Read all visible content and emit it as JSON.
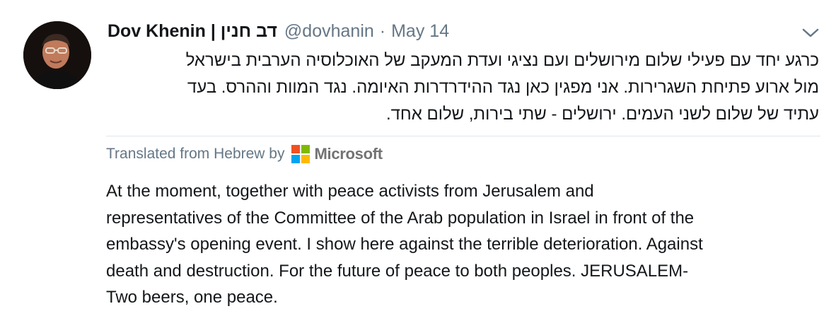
{
  "tweet": {
    "author_name": "Dov Khenin | דב חנין",
    "handle": "@dovhanin",
    "separator": "·",
    "date": "May 14",
    "hebrew_lines": [
      "כרגע יחד עם פעילי שלום מירושלים ועם נציגי ועדת המעקב של האוכלוסיה הערבית בישראל",
      "מול ארוע פתיחת השגרירות. אני מפגין כאן נגד ההידרדרות האיומה. נגד המוות וההרס. בעד",
      "עתיד של שלום לשני העמים. ירושלים - שתי בירות, שלום אחד."
    ],
    "translated_label": "Translated from Hebrew by",
    "translator_name": "Microsoft",
    "english_lines": [
      "At the moment, together with peace activists from Jerusalem and",
      "representatives of the Committee of the Arab population in Israel in front of the",
      "embassy's opening event. I show here against the terrible deterioration. Against",
      "death and destruction. For the future of peace to both peoples. JERUSALEM-",
      "Two beers, one peace."
    ]
  },
  "icons": {
    "avatar": "profile-photo",
    "menu": "chevron-down-icon",
    "translator_logo": "microsoft-logo-icon"
  },
  "colors": {
    "text_primary": "#14171a",
    "text_secondary": "#657786",
    "divider": "#e1e8ed",
    "ms_red": "#f25022",
    "ms_green": "#7fba00",
    "ms_blue": "#00a4ef",
    "ms_yellow": "#ffb900"
  }
}
